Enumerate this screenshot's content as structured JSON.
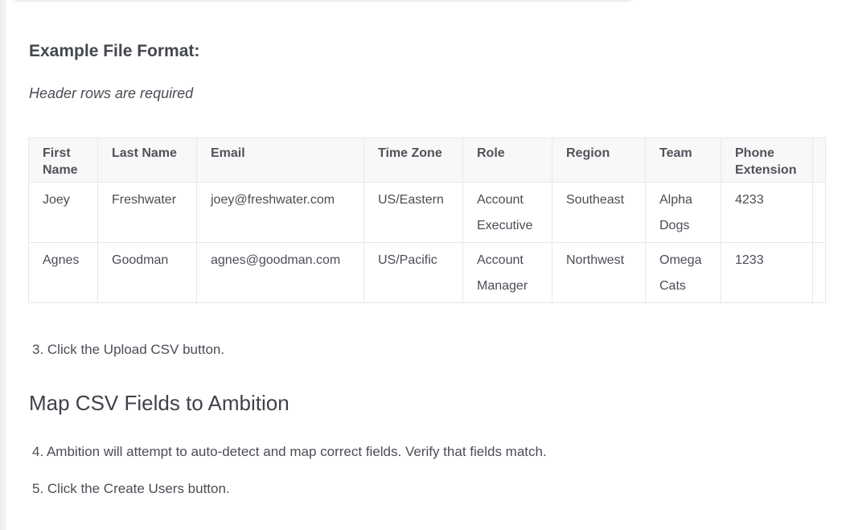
{
  "section_heading": "Example File Format:",
  "note": "Header rows are required",
  "table": {
    "columns": [
      "First Name",
      "Last Name",
      "Email",
      "Time Zone",
      "Role",
      "Region",
      "Team",
      "Phone Extension",
      ""
    ],
    "rows": [
      [
        "Joey",
        "Freshwater",
        "joey@freshwater.com",
        "US/Eastern",
        "Account Executive",
        "Southeast",
        "Alpha Dogs",
        "4233",
        ""
      ],
      [
        "Agnes",
        "Goodman",
        "agnes@goodman.com",
        "US/Pacific",
        "Account Manager",
        "Northwest",
        "Omega Cats",
        "1233",
        ""
      ]
    ]
  },
  "step3": "3. Click the Upload CSV button.",
  "map_heading": "Map CSV Fields to Ambition",
  "step4": "4. Ambition will attempt to auto-detect and map correct fields. Verify that fields match.",
  "step5": "5. Click the Create Users button."
}
